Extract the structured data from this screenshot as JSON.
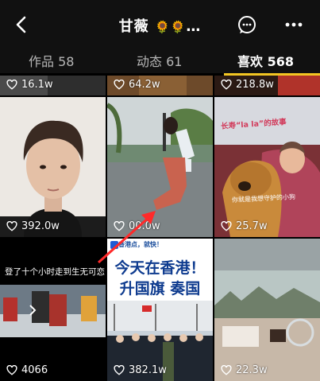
{
  "header": {
    "title": "甘薇",
    "title_suffix": "…",
    "sun_glyph": "🌻"
  },
  "tabs": [
    {
      "label": "作品 58"
    },
    {
      "label": "动态 61"
    },
    {
      "label": "喜欢 568"
    }
  ],
  "grid": {
    "top_row_likes": [
      "16.1w",
      "64.2w",
      "218.8w"
    ],
    "cells": [
      {
        "likes": "392.0w"
      },
      {
        "likes": "00.0w"
      },
      {
        "likes": "25.7w",
        "caption_top": "长寿“la la”的故事",
        "caption_bottom": "你就是我想守护的小狗"
      },
      {
        "likes": "4066",
        "caption": "登了十个小时走到生无可恋"
      },
      {
        "likes": "382.1w",
        "tag": "香港点，就快！",
        "headline_1": "今天在香港！",
        "headline_2": "升国旗 奏国歌！"
      },
      {
        "likes": "22.3w"
      }
    ]
  },
  "colors": {
    "accent": "#f3c623",
    "header_bg": "#111111",
    "arrow": "#ff2a2a"
  }
}
